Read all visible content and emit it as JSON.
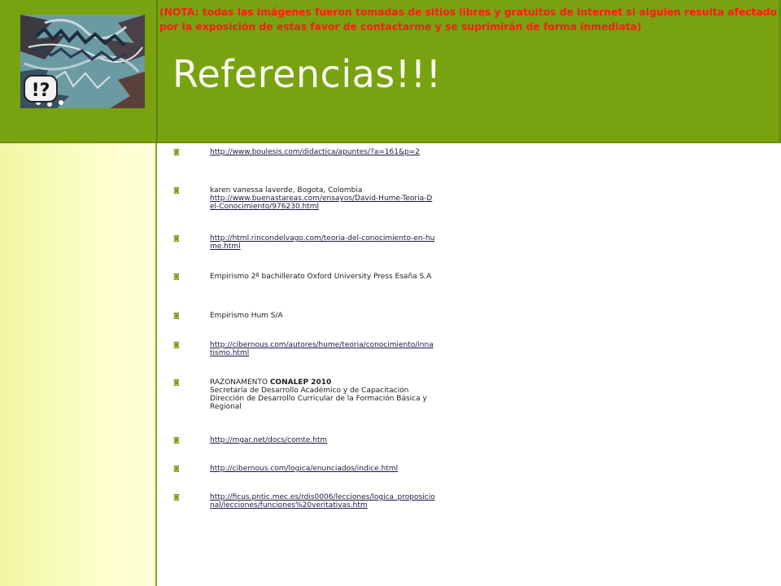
{
  "header": {
    "nota": "(NOTA: todas las imágenes fueron tomadas de sitios libres y gratuitos de internet si alguien resulta afectado por la exposición de estas favor de contactarme y se suprimirán de forma inmediata)",
    "title": "Referencias!!!"
  },
  "logo": {
    "icon": "interrobang-comic-logo",
    "text": "!?"
  },
  "colors": {
    "header_bg": "#78a20f",
    "left_bar_bg": "#f7fbba",
    "nota_text": "#ff1a1a",
    "title_text": "#fbfbf0",
    "bullet": "#7a9a12"
  },
  "references": [
    {
      "text": "",
      "link": "http://www.boulesis.com/didactica/apuntes/?a=161&p=2"
    },
    {
      "text": "karen vanessa laverde, Bogota, Colombia",
      "link": "http://www.buenastareas.com/ensayos/David-Hume-Teoria-Del-Conocimiento/976230.html"
    },
    {
      "text": "",
      "link": "http://html.rincondelvago.com/teoria-del-conocimiento-en-hume.html"
    },
    {
      "text": "Empirismo 2º bachillerato Oxford University Press Esaña S.A",
      "link": ""
    },
    {
      "text": "Empirismo Hum S/A",
      "link": ""
    },
    {
      "text": "",
      "link": "http://cibernous.com/autores/hume/teoria/conocimiento/innatismo.html"
    },
    {
      "text_prefix": "RAZONAMENTO ",
      "text_bold": "CONALEP 2010",
      "text_lines": [
        "Secretaría de Desarrollo Académico y de Capacitación",
        "Dirección de Desarrollo Curricular de la Formación Básica y Regional"
      ]
    },
    {
      "text": "",
      "link": "http://mgar.net/docs/comte.htm"
    },
    {
      "text": "",
      "link": "http://cibernous.com/logica/enunciados/indice.html"
    },
    {
      "text": "",
      "link": "http://ficus.pntic.mec.es/rdis0006/lecciones/logica_proposicional/lecciones/funciones%20veritativas.htm"
    }
  ],
  "bullet_glyph": "◙"
}
